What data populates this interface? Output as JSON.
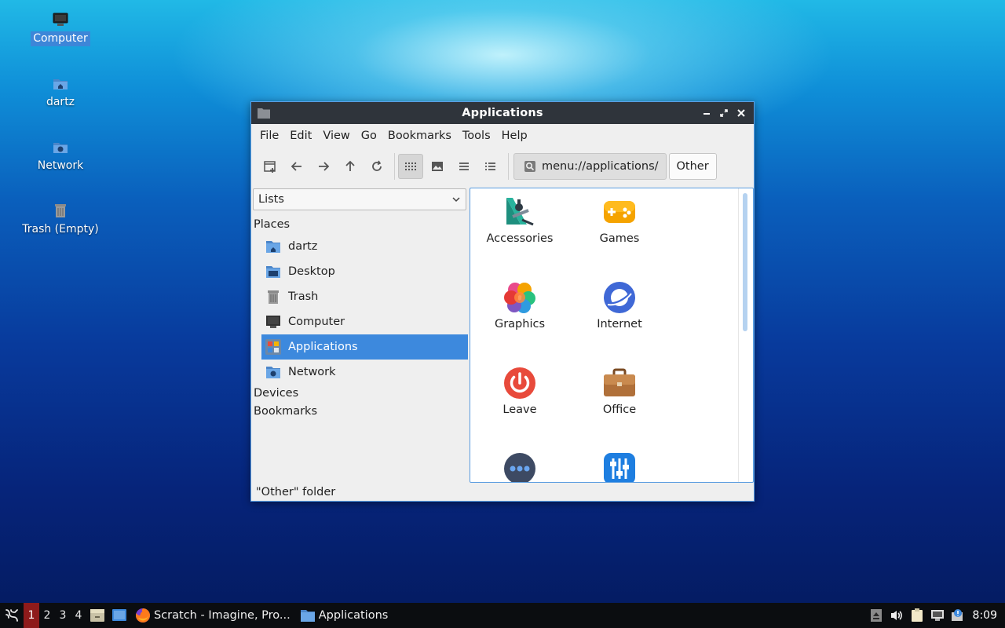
{
  "desktop": {
    "icons": [
      {
        "label": "Computer",
        "icon": "computer-icon",
        "selected": true
      },
      {
        "label": "dartz",
        "icon": "home-folder-icon"
      },
      {
        "label": "Network",
        "icon": "network-folder-icon"
      },
      {
        "label": "Trash (Empty)",
        "icon": "trash-icon"
      }
    ]
  },
  "window": {
    "title": "Applications",
    "controls": [
      "minimize",
      "maximize",
      "close"
    ],
    "menu": [
      "File",
      "Edit",
      "View",
      "Go",
      "Bookmarks",
      "Tools",
      "Help"
    ],
    "toolbar": {
      "buttons": [
        "new-tab-icon",
        "back-icon",
        "forward-icon",
        "up-icon",
        "reload-icon",
        "icon-view-icon",
        "thumbnail-view-icon",
        "compact-view-icon",
        "detailed-list-icon"
      ],
      "active_view": "icon-view",
      "path": "menu://applications/",
      "path_button": "Other"
    },
    "sidebar": {
      "mode": "Lists",
      "places_header": "Places",
      "places": [
        {
          "label": "dartz",
          "icon": "home-folder-icon"
        },
        {
          "label": "Desktop",
          "icon": "desktop-folder-icon"
        },
        {
          "label": "Trash",
          "icon": "trash-icon"
        },
        {
          "label": "Computer",
          "icon": "computer-icon"
        },
        {
          "label": "Applications",
          "icon": "applications-icon",
          "selected": true
        },
        {
          "label": "Network",
          "icon": "network-folder-icon"
        }
      ],
      "devices_header": "Devices",
      "bookmarks_header": "Bookmarks"
    },
    "items": [
      {
        "label": "Accessories",
        "icon": "accessories-icon"
      },
      {
        "label": "Games",
        "icon": "games-icon"
      },
      {
        "label": "Graphics",
        "icon": "graphics-icon"
      },
      {
        "label": "Internet",
        "icon": "internet-icon"
      },
      {
        "label": "Leave",
        "icon": "leave-icon"
      },
      {
        "label": "Office",
        "icon": "office-icon"
      },
      {
        "label": "",
        "icon": "other-icon"
      },
      {
        "label": "",
        "icon": "preferences-icon"
      }
    ],
    "status": "\"Other\" folder"
  },
  "taskbar": {
    "workspaces": [
      "1",
      "2",
      "3",
      "4"
    ],
    "active_workspace": "1",
    "tasks": [
      {
        "label": "Scratch - Imagine, Pro...",
        "icon": "firefox-icon"
      },
      {
        "label": "Applications",
        "icon": "folder-icon"
      }
    ],
    "clock": "8:09"
  },
  "colors": {
    "selection": "#3d89dd",
    "titlebar": "#2f343b",
    "taskbar": "#0b0d10",
    "active_workspace": "#8e1b1b"
  }
}
